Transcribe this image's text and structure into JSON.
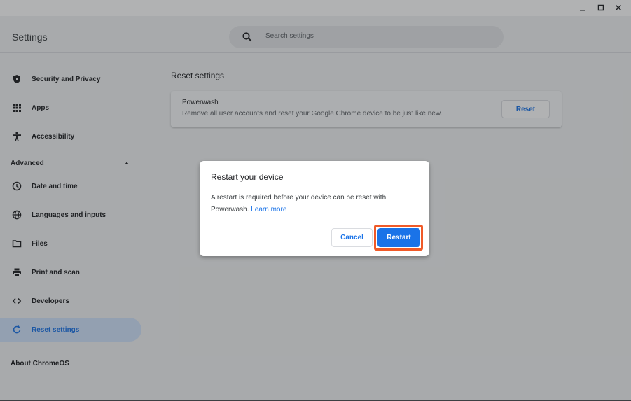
{
  "window": {
    "minimize_label": "_",
    "maximize_label": "□",
    "close_label": "✕"
  },
  "header": {
    "title": "Settings",
    "search": {
      "placeholder": "Search settings",
      "icon": "search-icon"
    }
  },
  "sidebar": {
    "items_top": [
      {
        "label": "Security and Privacy",
        "icon": "shield-icon"
      },
      {
        "label": "Apps",
        "icon": "apps-grid-icon"
      },
      {
        "label": "Accessibility",
        "icon": "accessibility-icon"
      }
    ],
    "advanced": {
      "label": "Advanced",
      "expanded": true
    },
    "items_advanced": [
      {
        "label": "Date and time",
        "icon": "clock-icon"
      },
      {
        "label": "Languages and inputs",
        "icon": "globe-icon"
      },
      {
        "label": "Files",
        "icon": "folder-icon"
      },
      {
        "label": "Print and scan",
        "icon": "printer-icon"
      },
      {
        "label": "Developers",
        "icon": "code-icon"
      },
      {
        "label": "Reset settings",
        "icon": "reset-icon",
        "active": true
      }
    ],
    "about": "About ChromeOS"
  },
  "main": {
    "section_title": "Reset settings",
    "powerwash": {
      "title": "Powerwash",
      "description": "Remove all user accounts and reset your Google Chrome device to be just like new.",
      "button": "Reset"
    }
  },
  "dialog": {
    "title": "Restart your device",
    "body_line1": "A restart is required before your device can be reset with",
    "body_line2": "Powerwash.",
    "link": "Learn more",
    "cancel": "Cancel",
    "restart": "Restart",
    "highlight_color": "#f05a28"
  },
  "colors": {
    "accent": "#1a73e8",
    "surface": "#f1f3f4",
    "active_nav": "#d2e3fc"
  }
}
